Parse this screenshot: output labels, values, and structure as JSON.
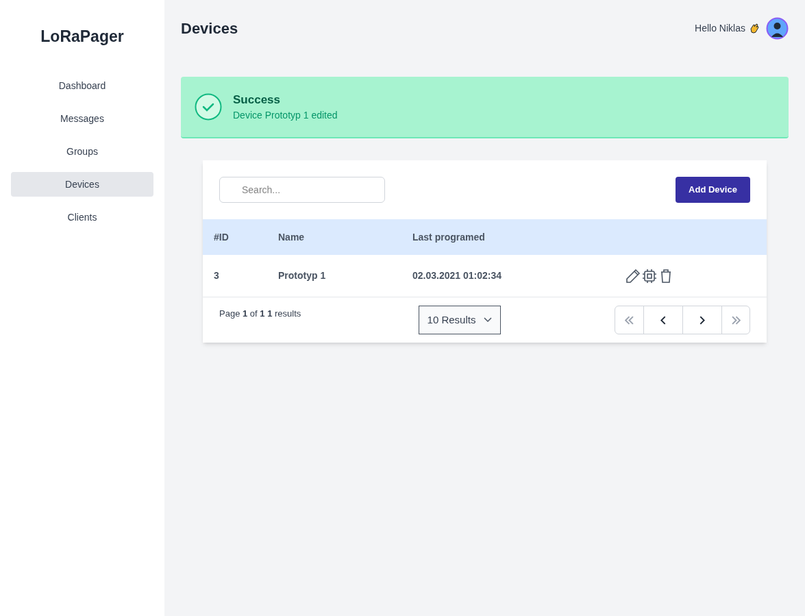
{
  "sidebar": {
    "logo": "LoRaPager",
    "items": [
      {
        "label": "Dashboard",
        "selected": false
      },
      {
        "label": "Messages",
        "selected": false
      },
      {
        "label": "Groups",
        "selected": false
      },
      {
        "label": "Devices",
        "selected": true
      },
      {
        "label": "Clients",
        "selected": false
      }
    ]
  },
  "header": {
    "title": "Devices",
    "greeting": "Hello Niklas"
  },
  "alert": {
    "title": "Success",
    "message": "Device Prototyp 1 edited"
  },
  "toolbar": {
    "search_placeholder": "Search...",
    "add_button": "Add Device"
  },
  "table": {
    "columns": [
      "#ID",
      "Name",
      "Last programed"
    ],
    "rows": [
      {
        "id": "3",
        "name": "Prototyp 1",
        "last_programed": "02.03.2021 01:02:34"
      }
    ]
  },
  "footer": {
    "page_info": "Page **1** of **1 1** results",
    "page_size": "10 Results",
    "pager": [
      {
        "kind": "first",
        "disabled": true
      },
      {
        "kind": "prev",
        "disabled": false
      },
      {
        "kind": "next",
        "disabled": false
      },
      {
        "kind": "last",
        "disabled": true
      }
    ]
  }
}
